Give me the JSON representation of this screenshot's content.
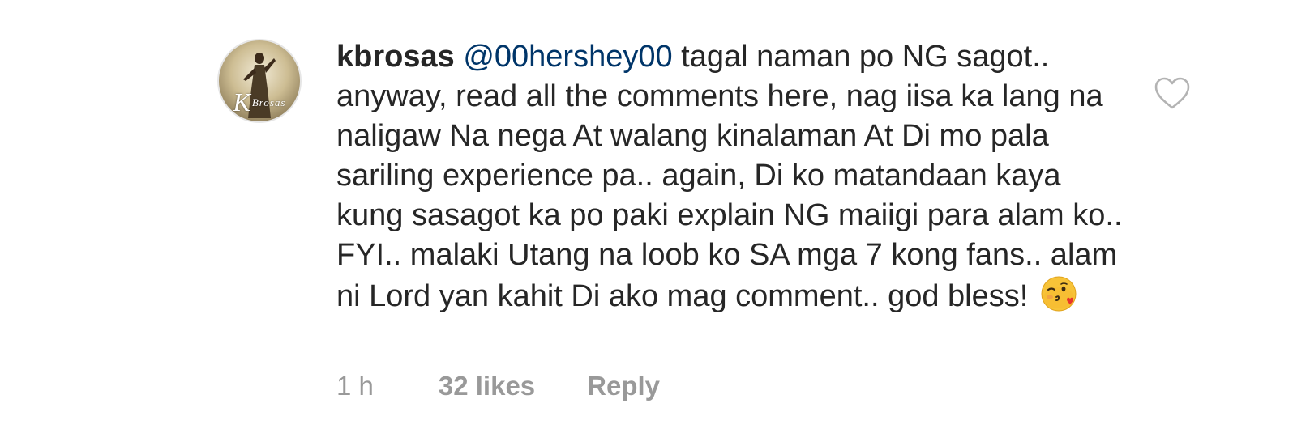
{
  "comment": {
    "username": "kbrosas",
    "mention": "@00hershey00",
    "text": " tagal naman po NG sagot.. anyway, read all the comments here, nag iisa ka lang na naligaw Na nega At walang kinalaman At Di mo pala sariling experience pa.. again, Di ko matandaan kaya kung sasagot ka po paki explain NG maiigi para alam ko.. FYI.. malaki Utang na loob ko SA mga 7 kong fans.. alam ni Lord yan kahit Di ako mag comment.. god bless! ",
    "emoji": "face-blowing-a-kiss",
    "avatar_text": {
      "initial": "K",
      "rest": "Brosas"
    },
    "timestamp": "1 h",
    "likes": "32 likes",
    "reply_label": "Reply",
    "like_icon": "heart-outline-icon"
  },
  "colors": {
    "text": "#262626",
    "mention": "#003569",
    "meta": "#999999",
    "icon": "#b3b3b3"
  }
}
